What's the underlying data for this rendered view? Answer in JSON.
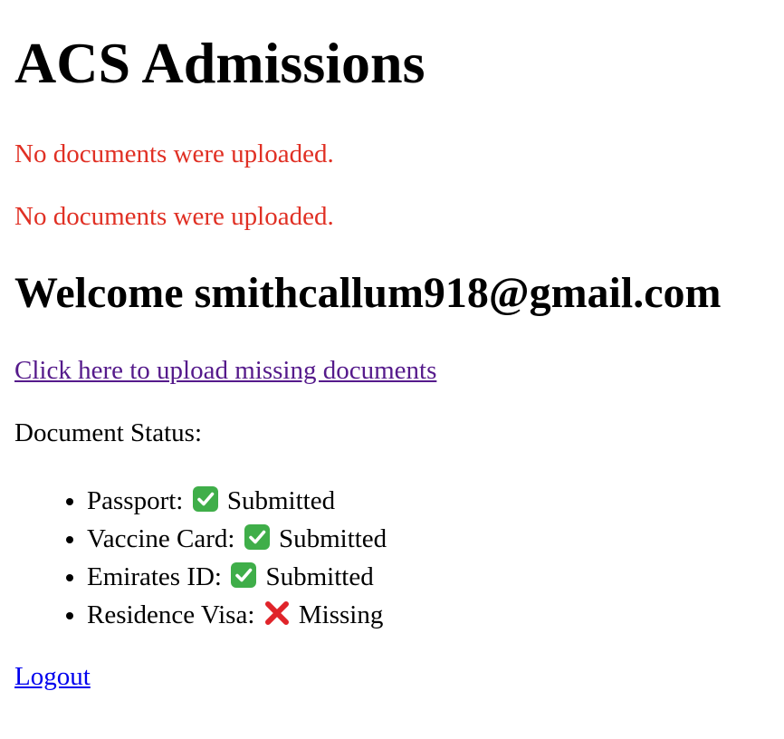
{
  "header": {
    "title": "ACS Admissions"
  },
  "messages": [
    "No documents were uploaded.",
    "No documents were uploaded."
  ],
  "welcome": {
    "text": "Welcome smithcallum918@gmail.com"
  },
  "upload_link": {
    "label": "Click here to upload missing documents"
  },
  "document_status": {
    "heading": "Document Status:",
    "items": [
      {
        "label": "Passport:",
        "icon": "check-icon",
        "status": "Submitted"
      },
      {
        "label": "Vaccine Card:",
        "icon": "check-icon",
        "status": "Submitted"
      },
      {
        "label": "Emirates ID:",
        "icon": "check-icon",
        "status": "Submitted"
      },
      {
        "label": "Residence Visa:",
        "icon": "cross-icon",
        "status": "Missing"
      }
    ]
  },
  "logout": {
    "label": "Logout"
  },
  "colors": {
    "error": "#e03024",
    "visited_link": "#551a8b",
    "link": "#0000ee",
    "check_green": "#3fae49",
    "cross_red": "#e0242a"
  }
}
